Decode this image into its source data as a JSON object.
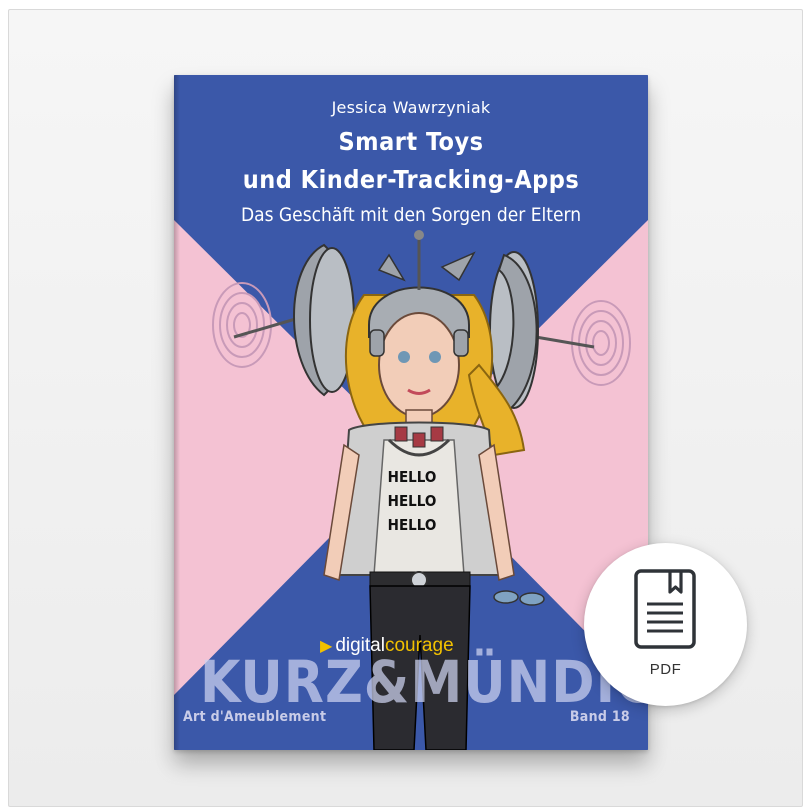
{
  "book": {
    "author": "Jessica Wawrzyniak",
    "title_line1": "Smart Toys",
    "title_line2": "und Kinder-Tracking-Apps",
    "subtitle": "Das Geschäft mit den Sorgen der Eltern",
    "shirt_lines": [
      "HELLO",
      "HELLO",
      "HELLO"
    ],
    "publisher_part1": "digital",
    "publisher_part2": "courage",
    "series_title": "KURZ&MÜNDIG",
    "series_sub": "Art d'Ameublement",
    "volume": "Band 18"
  },
  "badge": {
    "label": "PDF",
    "icon": "pdf-document-icon"
  },
  "colors": {
    "cover_blue": "#3b58a9",
    "cover_pink": "#f4c2d3",
    "publisher_accent": "#f2c100"
  }
}
